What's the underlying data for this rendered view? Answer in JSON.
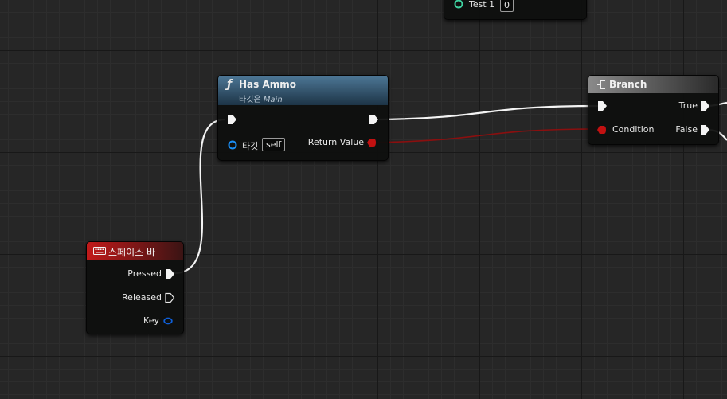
{
  "colors": {
    "exec_wire": "#f4f4f4",
    "bool_wire": "#8a0f0f",
    "bool_pin": "#c21111",
    "object_pin": "#1a8ff7",
    "struct_pin": "#0f5fd8",
    "green_pin": "#3fd1a0",
    "function_header": "#4d7796",
    "branch_header": "#8a8a8a",
    "event_header": "#c21a1a"
  },
  "nodes": {
    "test": {
      "label": "Test 1",
      "value": "0"
    },
    "has_ammo": {
      "icon": "function-icon",
      "glyph": "ƒ",
      "title": "Has Ammo",
      "subtitle_prefix": "타깃은",
      "subtitle_target": "Main",
      "target_label": "타깃",
      "target_value": "self",
      "return_label": "Return Value"
    },
    "branch": {
      "icon": "branch-icon",
      "title": "Branch",
      "condition_label": "Condition",
      "true_label": "True",
      "false_label": "False"
    },
    "space_bar": {
      "icon": "keyboard-icon",
      "title": "스페이스 바",
      "pressed_label": "Pressed",
      "released_label": "Released",
      "key_label": "Key"
    }
  }
}
